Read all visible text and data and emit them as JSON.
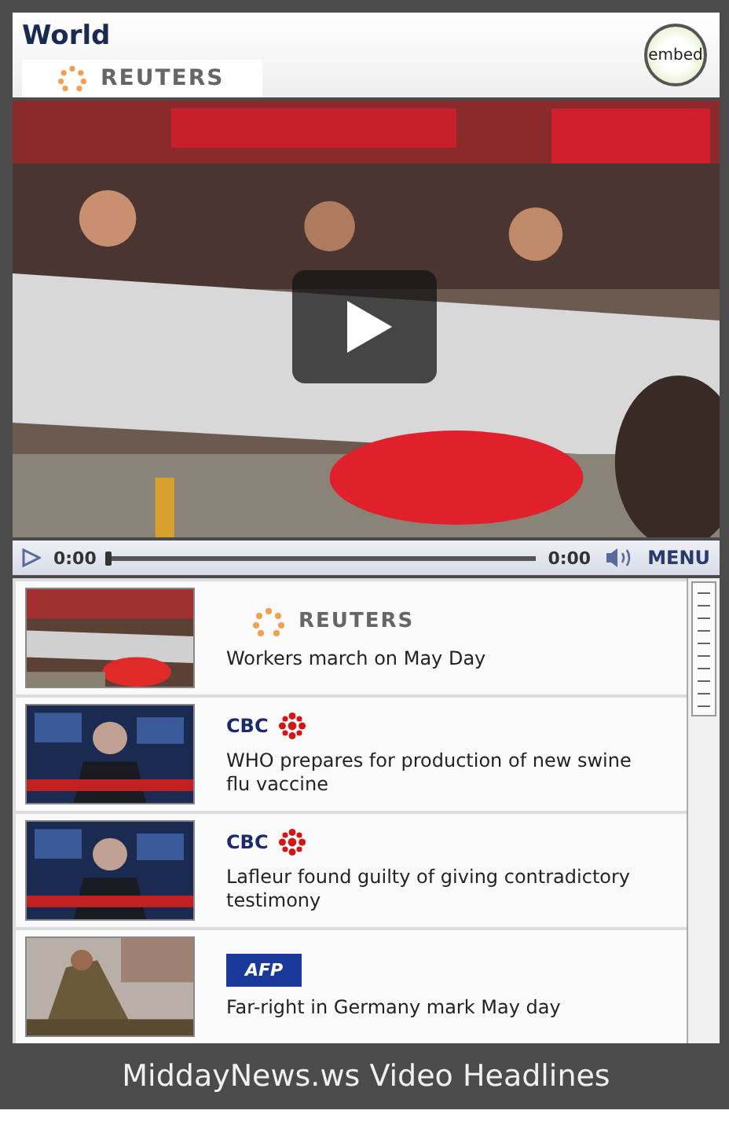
{
  "header": {
    "title": "World",
    "tab": {
      "source": "REUTERS",
      "selected": true
    },
    "embed_label": "embed"
  },
  "player": {
    "current_time": "0:00",
    "progress": {
      "level": 0
    },
    "total_time": "0:00",
    "menu_label": "MENU"
  },
  "headlines": [
    {
      "kind": "reuters",
      "source": "REUTERS",
      "title": "Workers march on May Day"
    },
    {
      "kind": "cbc",
      "source": "CBC",
      "title": "WHO prepares for production of new swine flu vaccine"
    },
    {
      "kind": "cbc",
      "source": "CBC",
      "title": "Lafleur found guilty of giving contradictory testimony"
    },
    {
      "kind": "afp",
      "source": "AFP",
      "title": "Far-right in Germany mark May day"
    }
  ],
  "footer": {
    "title": "MiddayNews.ws Video Headlines"
  }
}
